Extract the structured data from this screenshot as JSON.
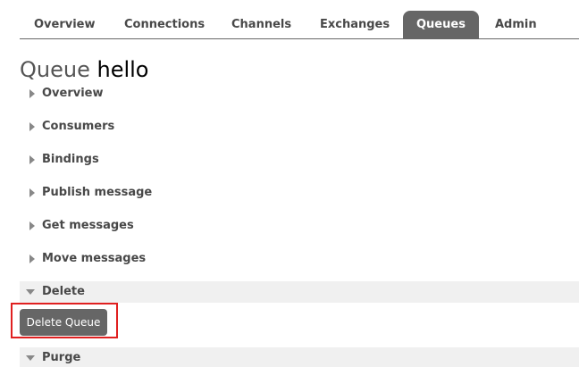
{
  "nav": {
    "tabs": [
      {
        "label": "Overview",
        "active": false
      },
      {
        "label": "Connections",
        "active": false
      },
      {
        "label": "Channels",
        "active": false
      },
      {
        "label": "Exchanges",
        "active": false
      },
      {
        "label": "Queues",
        "active": true
      },
      {
        "label": "Admin",
        "active": false
      }
    ]
  },
  "title": {
    "kind": "Queue",
    "name": "hello"
  },
  "sections": [
    {
      "label": "Overview",
      "expanded": false
    },
    {
      "label": "Consumers",
      "expanded": false
    },
    {
      "label": "Bindings",
      "expanded": false
    },
    {
      "label": "Publish message",
      "expanded": false
    },
    {
      "label": "Get messages",
      "expanded": false
    },
    {
      "label": "Move messages",
      "expanded": false
    },
    {
      "label": "Delete",
      "expanded": true
    },
    {
      "label": "Purge",
      "expanded": true
    }
  ],
  "delete_section": {
    "button_label": "Delete Queue"
  },
  "colors": {
    "tab_active_bg": "#666666",
    "highlight": "#e02020",
    "open_section_bg": "#f0f0f0"
  },
  "icons": {
    "collapsed": "caret-right-icon",
    "expanded": "caret-down-icon"
  }
}
